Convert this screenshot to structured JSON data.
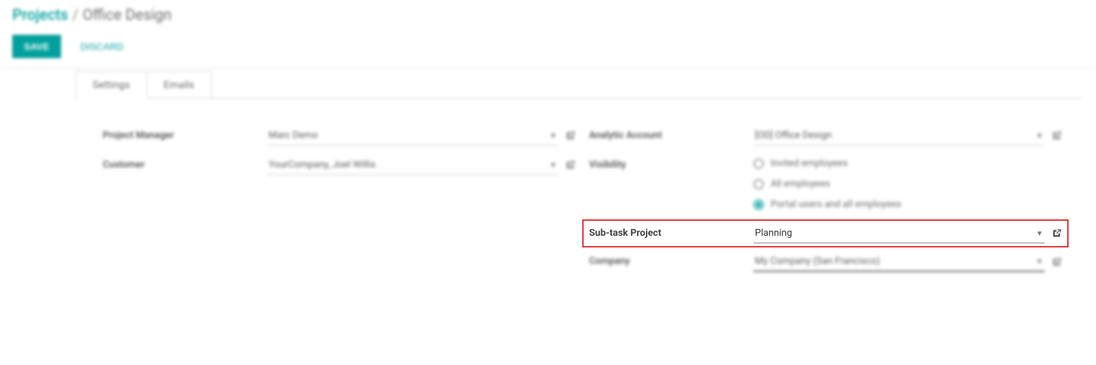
{
  "breadcrumb": {
    "root": "Projects",
    "sep": "/",
    "current": "Office Design"
  },
  "buttons": {
    "save": "SAVE",
    "discard": "DISCARD"
  },
  "tabs": {
    "settings": "Settings",
    "emails": "Emails"
  },
  "left": {
    "pm_label": "Project Manager",
    "pm_value": "Marc Demo",
    "customer_label": "Customer",
    "customer_value": "YourCompany, Joel Willis"
  },
  "right": {
    "analytic_label": "Analytic Account",
    "analytic_value": "[OD] Office Design",
    "visibility_label": "Visibility",
    "visibility_options": {
      "opt1": "Invited employees",
      "opt2": "All employees",
      "opt3": "Portal users and all employees"
    },
    "subtask_label": "Sub-task Project",
    "subtask_value": "Planning",
    "company_label": "Company",
    "company_value": "My Company (San Francisco)"
  }
}
